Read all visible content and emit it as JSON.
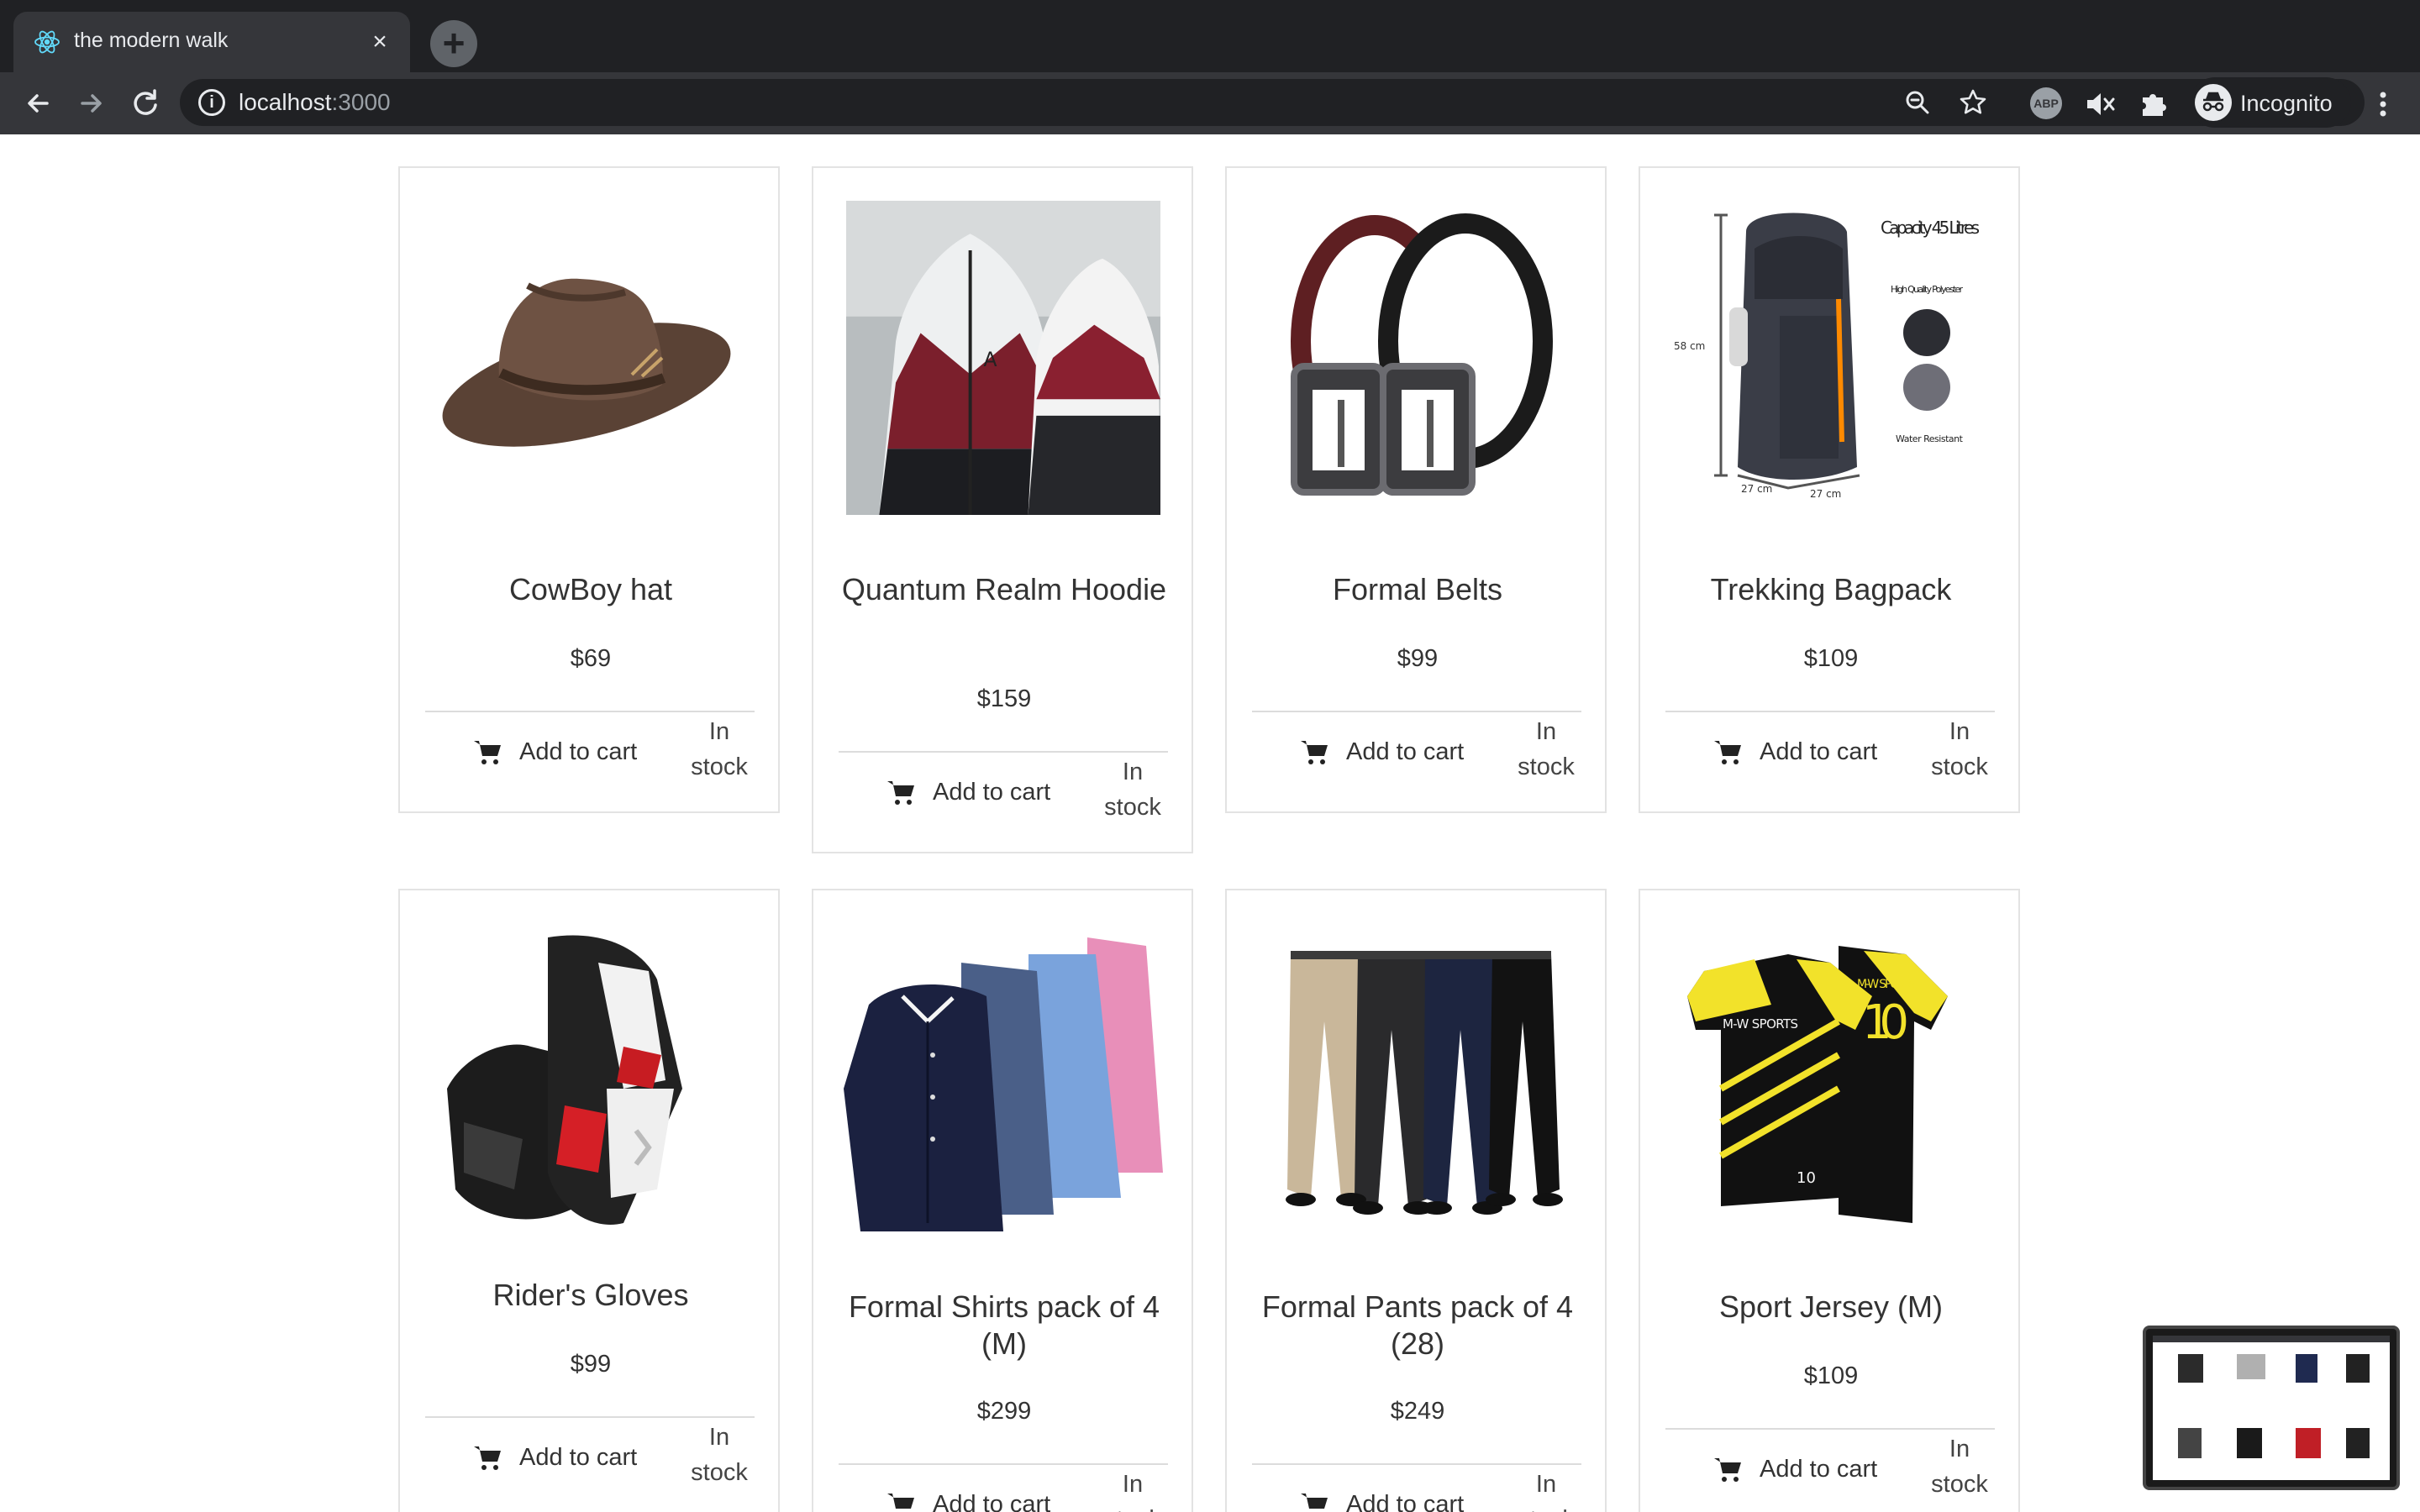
{
  "browser": {
    "tab_title": "the modern walk",
    "new_tab": "+",
    "url_host": "localhost",
    "url_port": ":3000",
    "profile_label": "Incognito",
    "abp_label": "ABP",
    "tab_close": "×"
  },
  "products": [
    {
      "title": "CowBoy hat",
      "price": "$69",
      "cart_label": "Add to cart",
      "stock_label": "In stock",
      "image": "cowboy-hat-image"
    },
    {
      "title": "Quantum Realm Hoodie",
      "price": "$159",
      "cart_label": "Add to cart",
      "stock_label": "In stock",
      "image": "hoodie-image"
    },
    {
      "title": "Formal Belts",
      "price": "$99",
      "cart_label": "Add to cart",
      "stock_label": "In stock",
      "image": "belts-image"
    },
    {
      "title": "Trekking Bagpack",
      "price": "$109",
      "cart_label": "Add to cart",
      "stock_label": "In stock",
      "image": "backpack-image",
      "image_text": {
        "capacity": "Capacity 45 Litres",
        "material": "High Quality Polyester",
        "water": "Water Resistant",
        "height": "58 cm",
        "width_a": "27 cm",
        "width_b": "27 cm"
      }
    },
    {
      "title": "Rider's Gloves",
      "price": "$99",
      "cart_label": "Add to cart",
      "stock_label": "In stock",
      "image": "gloves-image"
    },
    {
      "title": "Formal Shirts pack of 4 (M)",
      "price": "$299",
      "cart_label": "Add to cart",
      "stock_label": "In stock",
      "image": "shirts-image"
    },
    {
      "title": "Formal Pants pack of 4 (28)",
      "price": "$249",
      "cart_label": "Add to cart",
      "stock_label": "In stock",
      "image": "pants-image"
    },
    {
      "title": "Sport Jersey (M)",
      "price": "$109",
      "cart_label": "Add to cart",
      "stock_label": "In stock",
      "image": "jersey-image",
      "image_text": {
        "brand": "M-W SPORTS",
        "number": "10"
      }
    }
  ]
}
